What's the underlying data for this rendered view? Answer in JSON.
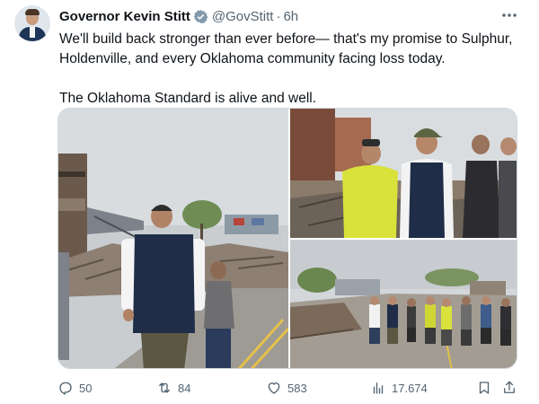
{
  "author": {
    "name": "Governor Kevin Stitt",
    "handle": "@GovStitt",
    "separator": "·",
    "time": "6h",
    "verified_badge_icon": "verified-badge-icon",
    "avatar_icon": "profile-avatar"
  },
  "more_icon": "more-horizontal-icon",
  "tweet": {
    "line1": "We'll build back stronger than ever before— that's my promise to Sulphur, Holdenville, and every Oklahoma community facing loss today.",
    "line2": "The Oklahoma Standard is alive and well."
  },
  "media": [
    {
      "name": "photo-governor-walking-debris",
      "icon": "photo"
    },
    {
      "name": "photo-governor-talking-crowd",
      "icon": "photo"
    },
    {
      "name": "photo-group-walking-street",
      "icon": "photo"
    }
  ],
  "actions": {
    "reply": {
      "icon": "reply-icon",
      "count": "50"
    },
    "retweet": {
      "icon": "retweet-icon",
      "count": "84"
    },
    "like": {
      "icon": "heart-icon",
      "count": "583"
    },
    "views": {
      "icon": "views-icon",
      "count": "17.674"
    },
    "bookmark": {
      "icon": "bookmark-icon"
    },
    "share": {
      "icon": "share-icon"
    }
  },
  "colors": {
    "text": "#0f1419",
    "secondary": "#536471",
    "verified": "#829aab",
    "border": "#cfd9de"
  }
}
